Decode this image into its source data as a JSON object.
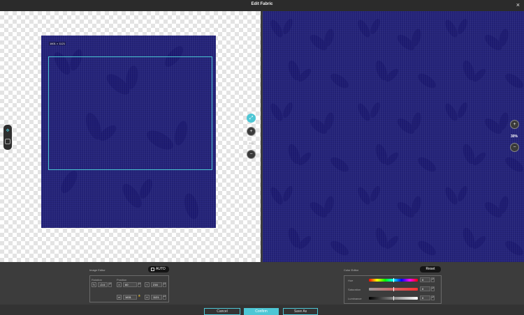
{
  "window": {
    "title": "Edit Fabric",
    "close_glyph": "×"
  },
  "left_view": {
    "crop_size_label": "1601 × 1121",
    "zoom_percent": "200"
  },
  "right_view": {
    "zoom_percent": "30%"
  },
  "icons": {
    "tool_transform": "move-icon",
    "tool_crop": "crop-icon",
    "zoom_in": "zoom-in-icon",
    "zoom_out": "zoom-out-icon",
    "fit": "fit-icon"
  },
  "image_editor": {
    "heading": "Image Editor",
    "auto_label": "AUTO",
    "rotation_label": "Rotation",
    "position_label": "Position",
    "rotation_value": "-0.4",
    "pos_x_label": "X",
    "pos_x_value": "60",
    "pos_y_label": "Y",
    "pos_y_value": "216",
    "width_label": "W",
    "width_value": "1631",
    "height_label": "H",
    "height_value": "1121"
  },
  "color_editor": {
    "heading": "Color Editor",
    "reset_label": "Reset",
    "hue_label": "Hue",
    "hue_value": "0",
    "hue_level": 0.5,
    "saturation_label": "Saturation",
    "saturation_value": "0",
    "saturation_level": 0.5,
    "luminance_label": "Luminance",
    "luminance_value": "0",
    "luminance_level": 0.5
  },
  "footer": {
    "cancel_label": "Cancel",
    "confirm_label": "Confirm",
    "save_as_label": "Save As"
  },
  "colors": {
    "accent": "#4ec7d5",
    "fabric": "#24237a"
  }
}
